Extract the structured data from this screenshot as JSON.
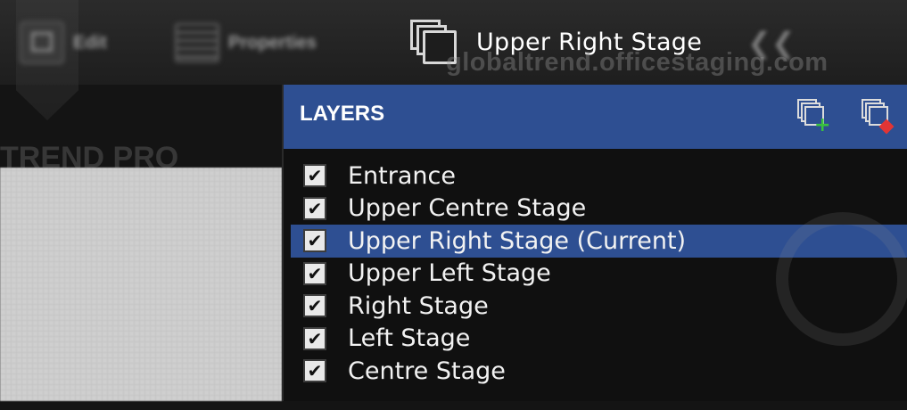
{
  "toolbar": {
    "edit_label": "Edit",
    "properties_label": "Properties",
    "current_layer_title": "Upper Right Stage",
    "collapse_icon": "double-chevron-left-icon"
  },
  "watermark": {
    "site": "globaltrend.officestaging.com",
    "brand": "TREND PRO"
  },
  "layers_panel": {
    "title": "LAYERS",
    "add_icon": "add-layer-icon",
    "delete_icon": "delete-layer-icon",
    "items": [
      {
        "label": "Entrance",
        "checked": true,
        "current": false
      },
      {
        "label": "Upper Centre Stage",
        "checked": true,
        "current": false
      },
      {
        "label": "Upper Right Stage (Current)",
        "checked": true,
        "current": true
      },
      {
        "label": "Upper Left Stage",
        "checked": true,
        "current": false
      },
      {
        "label": "Right Stage",
        "checked": true,
        "current": false
      },
      {
        "label": "Left Stage",
        "checked": true,
        "current": false
      },
      {
        "label": "Centre Stage",
        "checked": true,
        "current": false
      }
    ]
  },
  "colors": {
    "accent": "#2e4f92",
    "background": "#101010",
    "add_badge": "#39c23f",
    "delete_badge": "#e23535"
  }
}
